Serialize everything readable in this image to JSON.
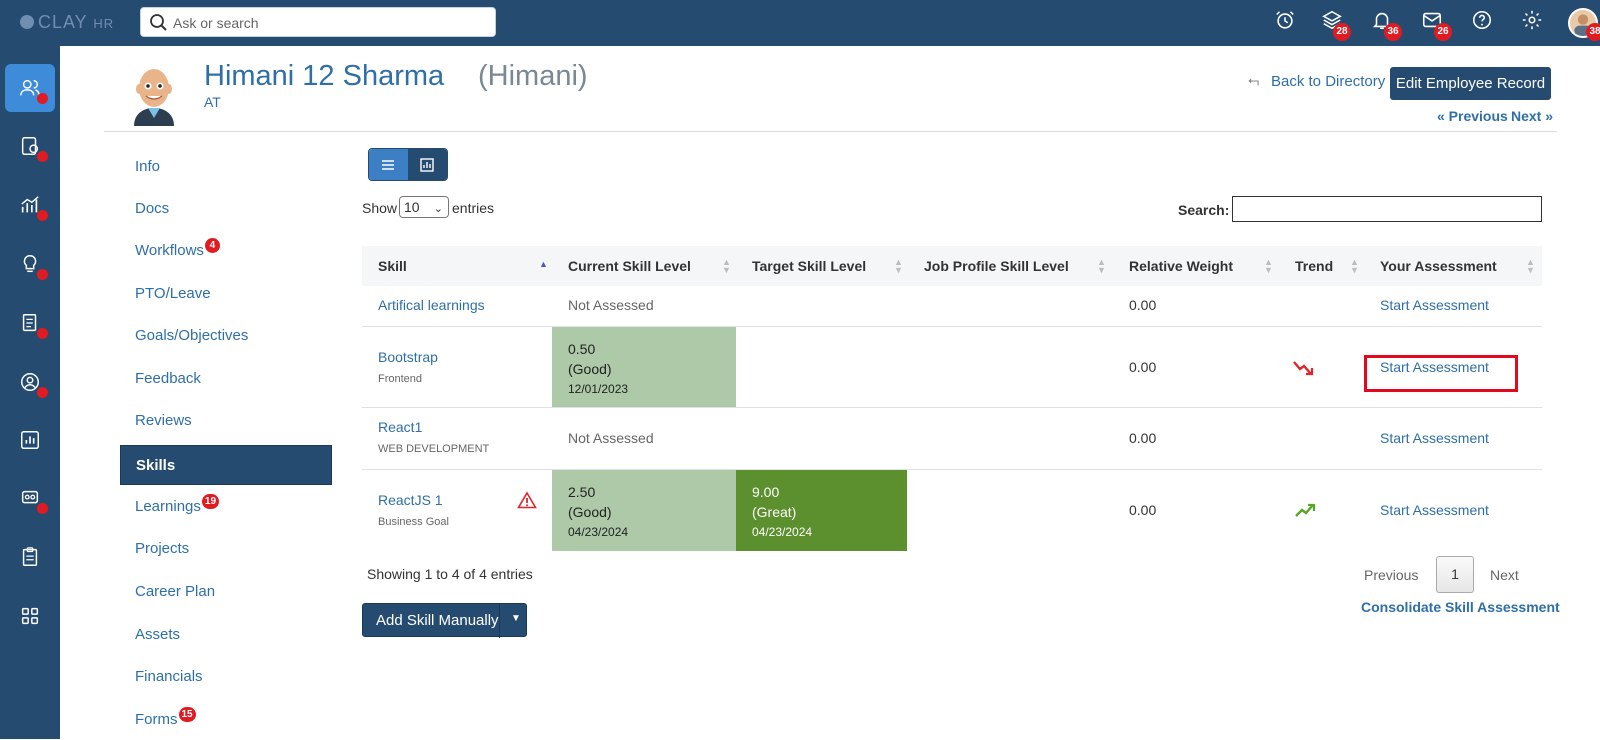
{
  "app": {
    "logo_main": "CLAY",
    "logo_suffix": "HR"
  },
  "search": {
    "placeholder": "Ask or search"
  },
  "topbar": {
    "icons": [
      {
        "name": "alarm-clock-icon",
        "badge": ""
      },
      {
        "name": "layers-icon",
        "badge": "28"
      },
      {
        "name": "bell-icon",
        "badge": "36"
      },
      {
        "name": "mail-icon",
        "badge": "26"
      },
      {
        "name": "help-icon",
        "badge": ""
      },
      {
        "name": "gear-icon",
        "badge": ""
      }
    ],
    "avatar_badge": "38"
  },
  "employee": {
    "name": "Himani 12 Sharma",
    "nickname": "(Himani)",
    "subtitle": "AT"
  },
  "header": {
    "back_label": "Back to Directory",
    "edit_label": "Edit Employee Record",
    "previous_label": "« Previous",
    "next_label": "Next »"
  },
  "subnav": {
    "items": [
      {
        "label": "Info",
        "badge": ""
      },
      {
        "label": "Docs",
        "badge": ""
      },
      {
        "label": "Workflows",
        "badge": "4"
      },
      {
        "label": "PTO/Leave",
        "badge": ""
      },
      {
        "label": "Goals/Objectives",
        "badge": ""
      },
      {
        "label": "Feedback",
        "badge": ""
      },
      {
        "label": "Reviews",
        "badge": ""
      },
      {
        "label": "Skills",
        "badge": ""
      },
      {
        "label": "Learnings",
        "badge": "19"
      },
      {
        "label": "Projects",
        "badge": ""
      },
      {
        "label": "Career Plan",
        "badge": ""
      },
      {
        "label": "Assets",
        "badge": ""
      },
      {
        "label": "Financials",
        "badge": ""
      },
      {
        "label": "Forms",
        "badge": "15"
      }
    ],
    "active": "Skills"
  },
  "table_controls": {
    "show_label": "Show",
    "entries_value": "10",
    "entries_label": "entries",
    "search_label": "Search:"
  },
  "table": {
    "headers": [
      "Skill",
      "Current Skill Level",
      "Target Skill Level",
      "Job Profile Skill Level",
      "Relative Weight",
      "Trend",
      "Your Assessment"
    ],
    "rows": [
      {
        "skill": "Artifical learnings",
        "category": "",
        "current": "Not Assessed",
        "weight": "0.00",
        "action": "Start Assessment"
      },
      {
        "skill": "Bootstrap",
        "category": "Frontend",
        "current_value": "0.50",
        "current_label": "(Good)",
        "current_date": "12/01/2023",
        "weight": "0.00",
        "trend": "down",
        "action": "Start Assessment"
      },
      {
        "skill": "React1",
        "category": "WEB DEVELOPMENT",
        "current": "Not Assessed",
        "weight": "0.00",
        "action": "Start Assessment"
      },
      {
        "skill": "ReactJS 1",
        "category": "Business Goal",
        "current_value": "2.50",
        "current_label": "(Good)",
        "current_date": "04/23/2024",
        "target_value": "9.00",
        "target_label": "(Great)",
        "target_date": "04/23/2024",
        "weight": "0.00",
        "trend": "up",
        "action": "Start Assessment"
      }
    ]
  },
  "footer": {
    "showing": "Showing 1 to 4 of 4 entries",
    "prev": "Previous",
    "page": "1",
    "next": "Next",
    "consolidate": "Consolidate Skill Assessment",
    "add_skill": "Add Skill Manually"
  },
  "colors": {
    "nav": "#254b71",
    "accent": "#3d8bd9",
    "good": "#adc9a8",
    "great": "#5c8f2e",
    "badge": "#e11b22"
  }
}
